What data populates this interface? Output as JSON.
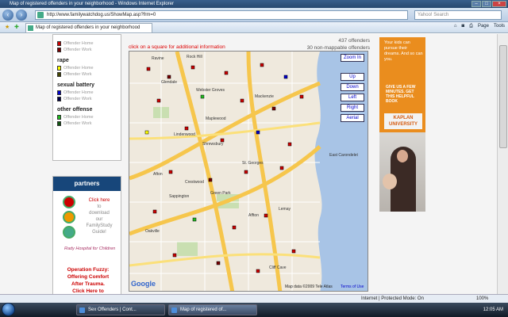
{
  "window": {
    "title": "Map of registered offenders in your neighborhood - Windows Internet Explorer"
  },
  "browser": {
    "url": "http://www.familywatchdog.us/ShowMap.asp?frm=0",
    "search_placeholder": "Yahoo! Search",
    "tab_title": "Map of registered offenders in your neighborhood",
    "cmd_page": "Page",
    "cmd_tools": "Tools"
  },
  "legend": {
    "categories": [
      {
        "items": [
          {
            "label": "Offender Home",
            "color": "#cc0000"
          },
          {
            "label": "Offender Work",
            "color": "#770000"
          }
        ]
      },
      {
        "heading": "rape",
        "items": [
          {
            "label": "Offender Home",
            "color": "#ffff00"
          },
          {
            "label": "Offender Work",
            "color": "#444400"
          }
        ]
      },
      {
        "heading": "sexual battery",
        "items": [
          {
            "label": "Offender Home",
            "color": "#0000cc"
          },
          {
            "label": "Offender Work",
            "color": "#000044"
          }
        ]
      },
      {
        "heading": "other offense",
        "items": [
          {
            "label": "Offender Home",
            "color": "#22bb22"
          },
          {
            "label": "Offender Work",
            "color": "#115511"
          }
        ]
      }
    ]
  },
  "partners": {
    "heading": "partners",
    "promo": [
      "Click here",
      "to",
      "download",
      "our",
      "FamilyStudy",
      "Guide!"
    ],
    "hospital": "Rady Hospital for Children",
    "fuzzy": [
      "Operation Fuzzy:",
      "Offering Comfort",
      "After Trauma.",
      "Click Here to"
    ]
  },
  "map": {
    "hint": "click on a square for additional information",
    "offender_count": "437 offenders",
    "unmappable": "30 non-mappable offenders",
    "controls": {
      "zoom_in": "Zoom In",
      "up": "Up",
      "down": "Down",
      "left": "Left",
      "right": "Right",
      "aerial": "Aerial"
    },
    "places": [
      "Rock Hill",
      "Ravine",
      "Glendale",
      "Webster Groves",
      "Maplewood",
      "Mackenzie",
      "Shrewsbury",
      "Crestwood",
      "St. Georges",
      "Green Park",
      "Sappington",
      "Afton",
      "Lemay",
      "Cliff Cave",
      "East Carondelet",
      "Affton",
      "Oakville",
      "Lindenwood"
    ],
    "copyright": "Map data ©2009 Tele Atlas",
    "terms": "Terms of Use",
    "logo": "Google"
  },
  "ad": {
    "text1": "Your kids can pursue their dreams. And so can you.",
    "text2": "GIVE US A FEW MINUTES. GET THIS HELPFUL BOOK",
    "brand": "KAPLAN UNIVERSITY"
  },
  "status": {
    "zone": "Internet | Protected Mode: On",
    "zoom": "100%"
  },
  "taskbar": {
    "items": [
      "Sex Offenders | Cont...",
      "Map of registered of..."
    ],
    "clock": "12:05 AM"
  }
}
